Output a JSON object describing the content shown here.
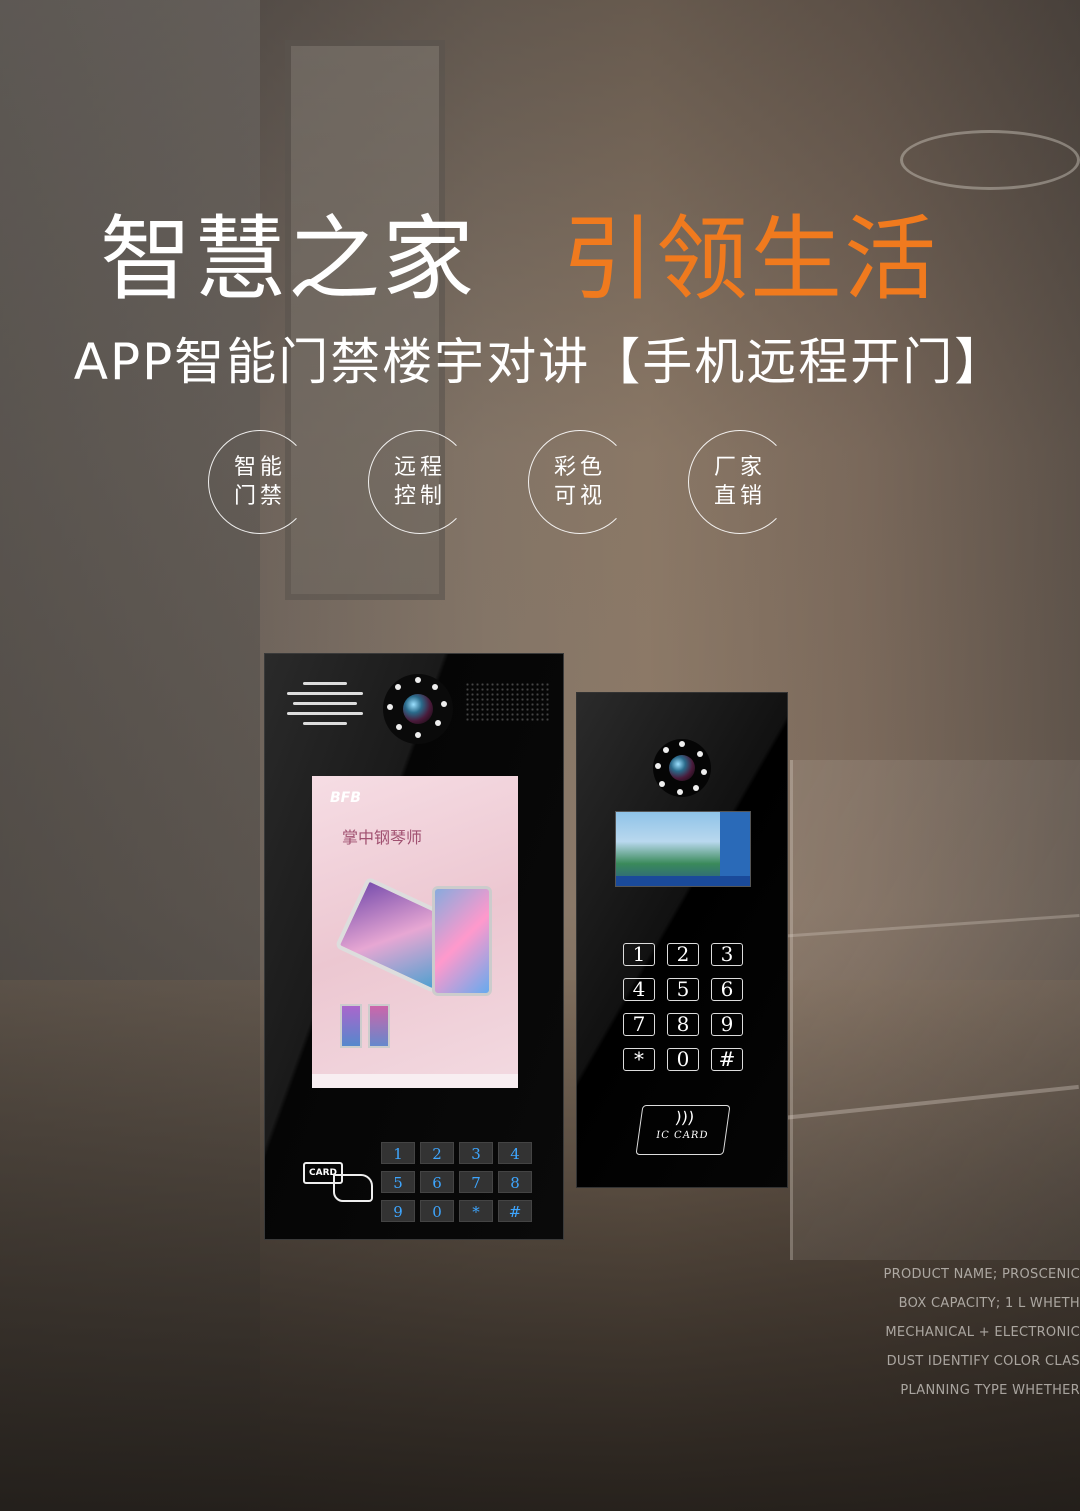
{
  "headline": {
    "left": "智慧之家",
    "right": "引领生活",
    "accent_color": "#f07a1e"
  },
  "subtitle": "APP智能门禁楼宇对讲【手机远程开门】",
  "badges": [
    {
      "line1": "智能",
      "line2": "门禁"
    },
    {
      "line1": "远程",
      "line2": "控制"
    },
    {
      "line1": "彩色",
      "line2": "可视"
    },
    {
      "line1": "厂家",
      "line2": "直销"
    }
  ],
  "device1": {
    "brand": "BFB",
    "ad_title": "掌中钢琴师",
    "card_label": "CARD",
    "keys": [
      "1",
      "2",
      "3",
      "4",
      "5",
      "6",
      "7",
      "8",
      "9",
      "0",
      "*",
      "#"
    ]
  },
  "device2": {
    "keys": [
      "1",
      "2",
      "3",
      "4",
      "5",
      "6",
      "7",
      "8",
      "9",
      "*",
      "0",
      "#"
    ],
    "ic_label": "IC CARD",
    "wifi_icon": ")))"
  },
  "specs": [
    "PRODUCT NAME; PROSCENIC",
    "BOX CAPACITY; 1 L WHETH",
    "MECHANICAL + ELECTRONIC",
    "DUST IDENTIFY COLOR CLAS",
    "PLANNING TYPE WHETHER"
  ]
}
